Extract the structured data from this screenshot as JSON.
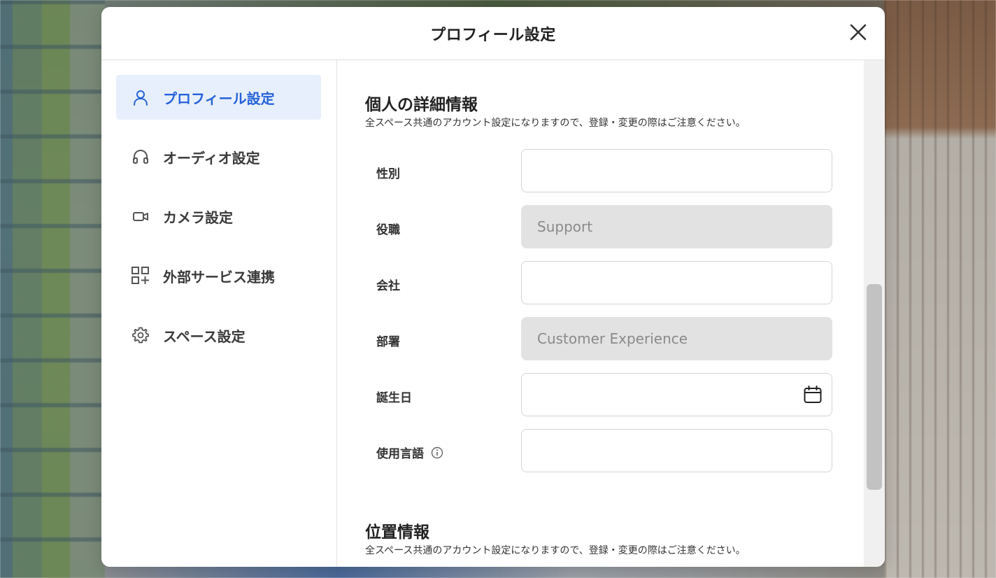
{
  "modal": {
    "title": "プロフィール設定",
    "close_icon": "close-icon"
  },
  "sidebar": {
    "items": [
      {
        "label": "プロフィール設定",
        "icon": "user-icon",
        "active": true
      },
      {
        "label": "オーディオ設定",
        "icon": "headphones-icon",
        "active": false
      },
      {
        "label": "カメラ設定",
        "icon": "video-camera-icon",
        "active": false
      },
      {
        "label": "外部サービス連携",
        "icon": "apps-add-icon",
        "active": false
      },
      {
        "label": "スペース設定",
        "icon": "gear-icon",
        "active": false
      }
    ]
  },
  "personal_section": {
    "title": "個人の詳細情報",
    "description": "全スペース共通のアカウント設定になりますので、登録・変更の際はご注意ください。",
    "fields": [
      {
        "label": "性別",
        "value": "",
        "disabled": false
      },
      {
        "label": "役職",
        "value": "Support",
        "disabled": true
      },
      {
        "label": "会社",
        "value": "",
        "disabled": false
      },
      {
        "label": "部署",
        "value": "Customer Experience",
        "disabled": true
      },
      {
        "label": "誕生日",
        "value": "",
        "disabled": false,
        "icon": "calendar-icon"
      },
      {
        "label": "使用言語",
        "value": "",
        "disabled": false,
        "icon": "info-icon"
      }
    ]
  },
  "location_section": {
    "title": "位置情報",
    "description": "全スペース共通のアカウント設定になりますので、登録・変更の際はご注意ください。"
  },
  "colors": {
    "accent": "#2563d8",
    "active_bg": "#e8effc",
    "disabled_field_bg": "#e2e2e2",
    "text": "#333333"
  }
}
